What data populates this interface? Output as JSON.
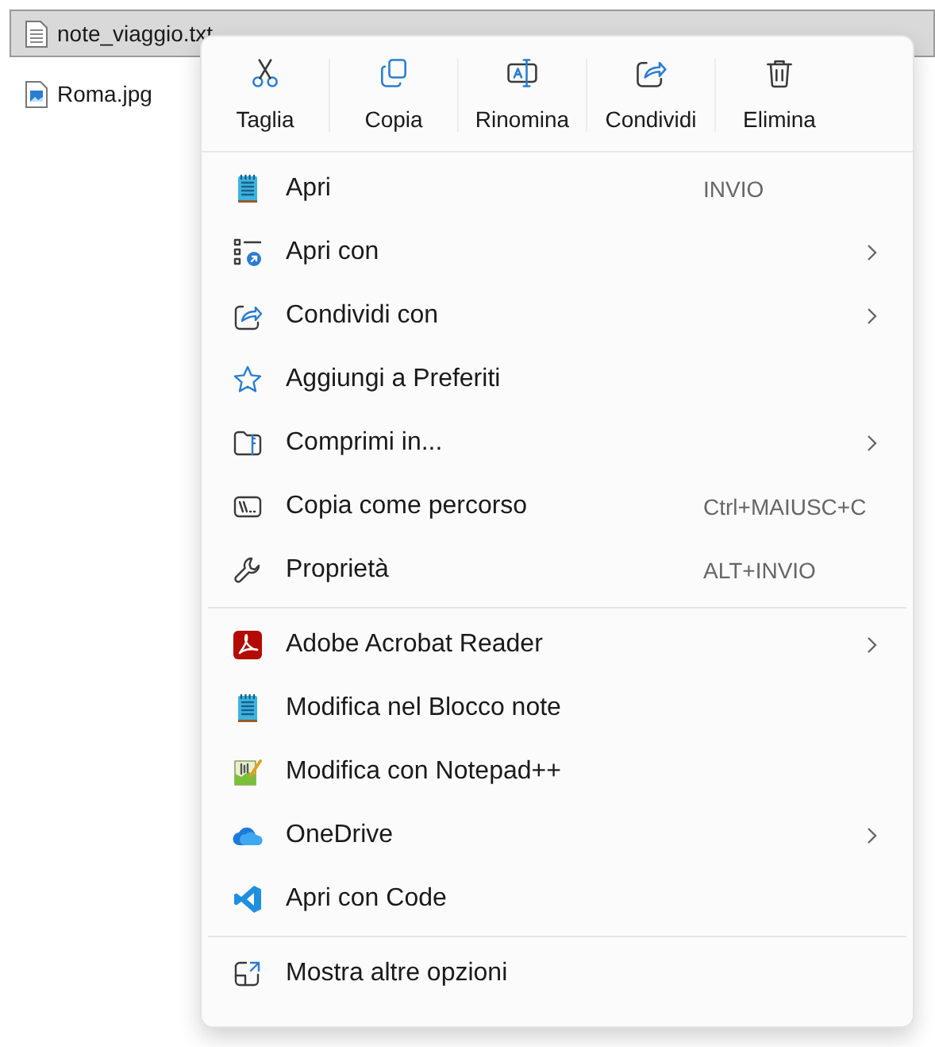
{
  "file_list": {
    "rows": [
      {
        "name": "note_viaggio.txt",
        "selected": true,
        "kind": "text"
      },
      {
        "name": "Roma.jpg",
        "selected": false,
        "kind": "image"
      }
    ]
  },
  "context_menu": {
    "actions": [
      {
        "label": "Taglia",
        "kind": "cut"
      },
      {
        "label": "Copia",
        "kind": "copy"
      },
      {
        "label": "Rinomina",
        "kind": "rename"
      },
      {
        "label": "Condividi",
        "kind": "share"
      },
      {
        "label": "Elimina",
        "kind": "delete"
      }
    ],
    "sections": [
      [
        {
          "label": "Apri",
          "shortcut": "INVIO",
          "submenu": false,
          "kind": "notepad"
        },
        {
          "label": "Apri con",
          "submenu": true,
          "kind": "open-with"
        },
        {
          "label": "Condividi con",
          "submenu": true,
          "kind": "share"
        },
        {
          "label": "Aggiungi a Preferiti",
          "submenu": false,
          "kind": "star"
        },
        {
          "label": "Comprimi in...",
          "submenu": true,
          "kind": "zip"
        },
        {
          "label": "Copia come percorso",
          "shortcut": "Ctrl+MAIUSC+C",
          "submenu": false,
          "kind": "path"
        },
        {
          "label": "Proprietà",
          "shortcut": "ALT+INVIO",
          "submenu": false,
          "kind": "wrench"
        }
      ],
      [
        {
          "label": "Adobe Acrobat Reader",
          "submenu": true,
          "kind": "pdf"
        },
        {
          "label": "Modifica nel Blocco note",
          "submenu": false,
          "kind": "notepad"
        },
        {
          "label": "Modifica con Notepad++",
          "submenu": false,
          "kind": "notepadpp"
        },
        {
          "label": "OneDrive",
          "submenu": true,
          "kind": "cloud"
        },
        {
          "label": "Apri con Code",
          "submenu": false,
          "kind": "code"
        }
      ],
      [
        {
          "label": "Mostra altre opzioni",
          "submenu": false,
          "kind": "more"
        }
      ]
    ]
  }
}
